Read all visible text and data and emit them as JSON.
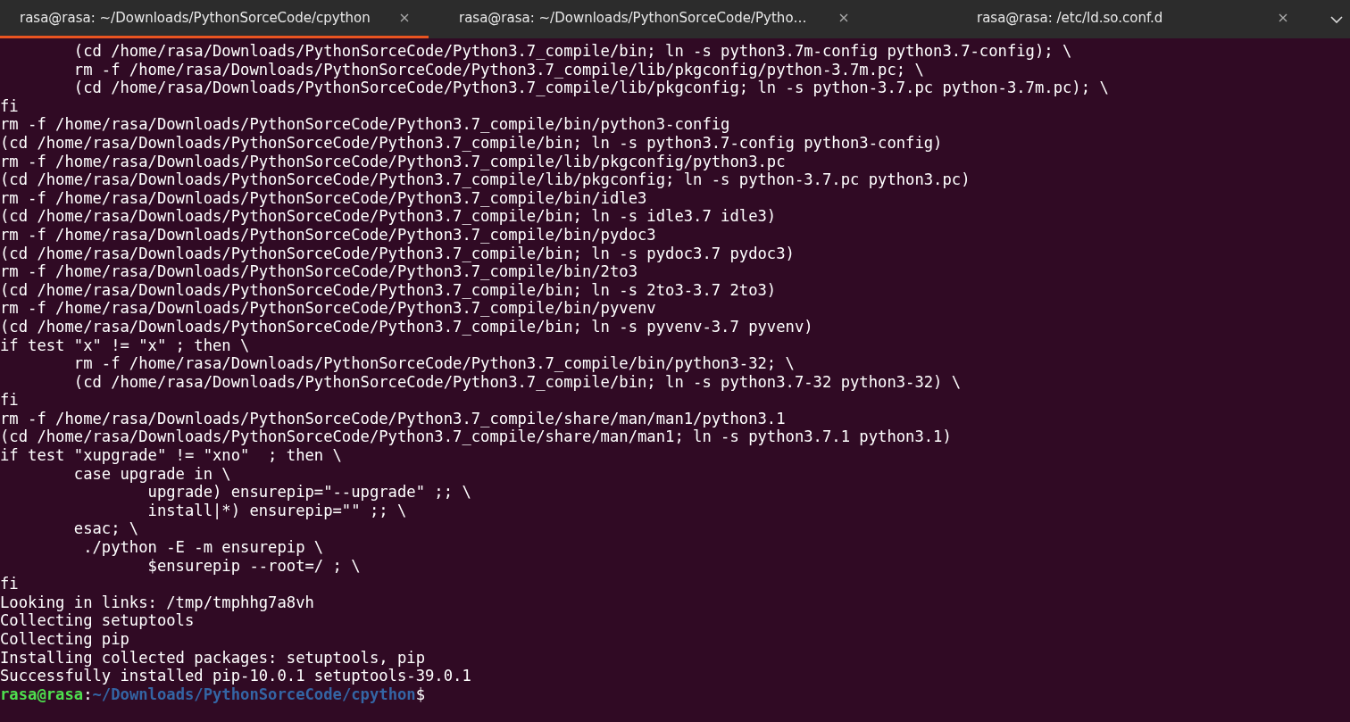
{
  "tabs": [
    {
      "title": "rasa@rasa: ~/Downloads/PythonSorceCode/cpython",
      "selected": true
    },
    {
      "title": "rasa@rasa: ~/Downloads/PythonSorceCode/Pytho…",
      "selected": false
    },
    {
      "title": "rasa@rasa: /etc/ld.so.conf.d",
      "selected": false
    }
  ],
  "lines": [
    "        (cd /home/rasa/Downloads/PythonSorceCode/Python3.7_compile/bin; ln -s python3.7m-config python3.7-config); \\",
    "        rm -f /home/rasa/Downloads/PythonSorceCode/Python3.7_compile/lib/pkgconfig/python-3.7m.pc; \\",
    "        (cd /home/rasa/Downloads/PythonSorceCode/Python3.7_compile/lib/pkgconfig; ln -s python-3.7.pc python-3.7m.pc); \\",
    "fi",
    "rm -f /home/rasa/Downloads/PythonSorceCode/Python3.7_compile/bin/python3-config",
    "(cd /home/rasa/Downloads/PythonSorceCode/Python3.7_compile/bin; ln -s python3.7-config python3-config)",
    "rm -f /home/rasa/Downloads/PythonSorceCode/Python3.7_compile/lib/pkgconfig/python3.pc",
    "(cd /home/rasa/Downloads/PythonSorceCode/Python3.7_compile/lib/pkgconfig; ln -s python-3.7.pc python3.pc)",
    "rm -f /home/rasa/Downloads/PythonSorceCode/Python3.7_compile/bin/idle3",
    "(cd /home/rasa/Downloads/PythonSorceCode/Python3.7_compile/bin; ln -s idle3.7 idle3)",
    "rm -f /home/rasa/Downloads/PythonSorceCode/Python3.7_compile/bin/pydoc3",
    "(cd /home/rasa/Downloads/PythonSorceCode/Python3.7_compile/bin; ln -s pydoc3.7 pydoc3)",
    "rm -f /home/rasa/Downloads/PythonSorceCode/Python3.7_compile/bin/2to3",
    "(cd /home/rasa/Downloads/PythonSorceCode/Python3.7_compile/bin; ln -s 2to3-3.7 2to3)",
    "rm -f /home/rasa/Downloads/PythonSorceCode/Python3.7_compile/bin/pyvenv",
    "(cd /home/rasa/Downloads/PythonSorceCode/Python3.7_compile/bin; ln -s pyvenv-3.7 pyvenv)",
    "if test \"x\" != \"x\" ; then \\",
    "        rm -f /home/rasa/Downloads/PythonSorceCode/Python3.7_compile/bin/python3-32; \\",
    "        (cd /home/rasa/Downloads/PythonSorceCode/Python3.7_compile/bin; ln -s python3.7-32 python3-32) \\",
    "fi",
    "rm -f /home/rasa/Downloads/PythonSorceCode/Python3.7_compile/share/man/man1/python3.1",
    "(cd /home/rasa/Downloads/PythonSorceCode/Python3.7_compile/share/man/man1; ln -s python3.7.1 python3.1)",
    "if test \"xupgrade\" != \"xno\"  ; then \\",
    "        case upgrade in \\",
    "                upgrade) ensurepip=\"--upgrade\" ;; \\",
    "                install|*) ensurepip=\"\" ;; \\",
    "        esac; \\",
    "         ./python -E -m ensurepip \\",
    "                $ensurepip --root=/ ; \\",
    "fi",
    "Looking in links: /tmp/tmphhg7a8vh",
    "Collecting setuptools",
    "Collecting pip",
    "Installing collected packages: setuptools, pip",
    "Successfully installed pip-10.0.1 setuptools-39.0.1"
  ],
  "prompt": {
    "user": "rasa@rasa",
    "separator": ":",
    "path": "~/Downloads/PythonSorceCode/cpython",
    "symbol": "$"
  }
}
